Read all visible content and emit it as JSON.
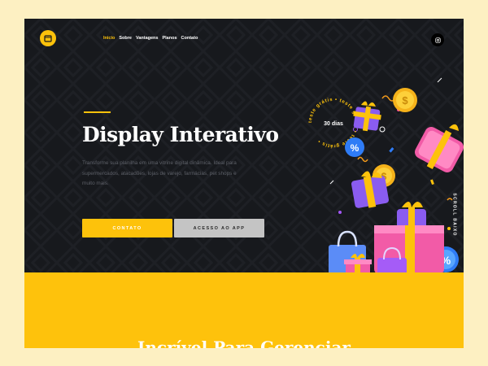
{
  "nav": {
    "items": [
      "Inicio",
      "Sobre",
      "Vantagens",
      "Planos",
      "Contato"
    ]
  },
  "hero": {
    "title": "Display Interativo",
    "description": "Transforme sua planilha em uma vitrine digital dinâmica. Ideal para supermercados, atacadões, lojas de varejo, farmácias, pet shops e muito mais.",
    "button_contact": "CONTATO",
    "button_app": "ACESSO AO APP",
    "badge_days": "30 dias",
    "badge_ring": "teste grátis • teste grátis • teste grátis •",
    "scroll_label": "SCROLL BAIXO"
  },
  "section2": {
    "title": "Incrível Para Gerenciar"
  },
  "icons": {
    "logo": "calendar-icon",
    "social": "instagram-icon"
  },
  "colors": {
    "accent": "#fdc20b",
    "hero_bg": "#17191d",
    "page_bg": "#fdf0c2"
  }
}
